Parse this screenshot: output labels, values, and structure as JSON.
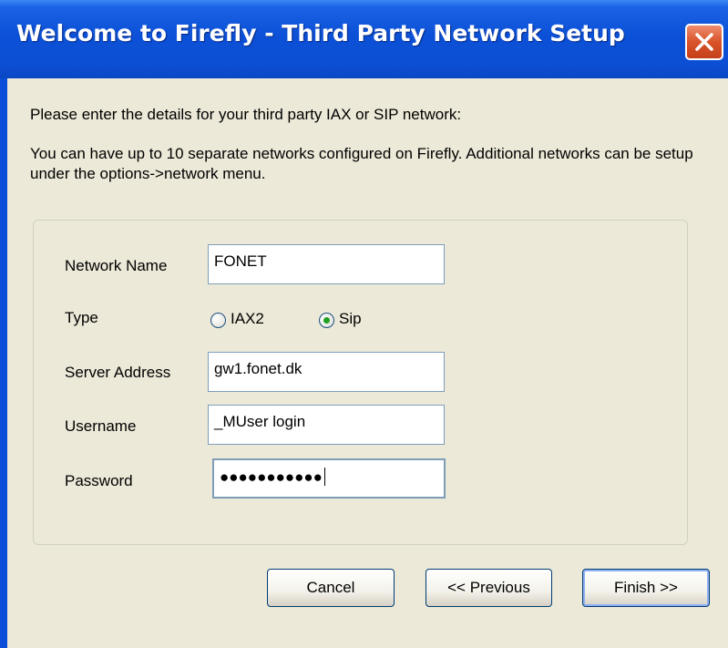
{
  "window": {
    "title": "Welcome to Firefly - Third Party Network Setup"
  },
  "intro": {
    "line1": "Please enter the details for your third party IAX or SIP network:",
    "line2": "You can have up to 10 separate networks configured on Firefly. Additional networks can be setup under the options->network menu."
  },
  "form": {
    "network_name_label": "Network Name",
    "network_name_value": "FONET",
    "type_label": "Type",
    "type_options": [
      {
        "label": "IAX2",
        "selected": false
      },
      {
        "label": "Sip",
        "selected": true
      }
    ],
    "server_address_label": "Server Address",
    "server_address_value": "gw1.fonet.dk",
    "username_label": "Username",
    "username_value": "_MUser login",
    "password_label": "Password",
    "password_value": "●●●●●●●●●●●"
  },
  "buttons": {
    "cancel": "Cancel",
    "previous": "<< Previous",
    "finish": "Finish >>"
  },
  "colors": {
    "titlebar": "#0b50d6",
    "client_background": "#ece9d8",
    "close_button": "#d9532a",
    "radio_checked": "#21a121"
  },
  "icons": {
    "close": "close-icon"
  }
}
